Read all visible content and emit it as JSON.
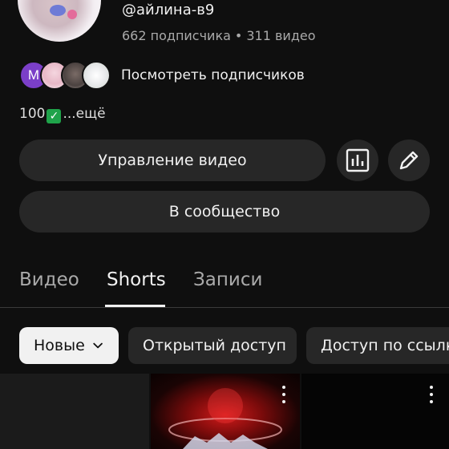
{
  "channel": {
    "handle": "@айлина-в9",
    "subscribers": "662 подписчика",
    "separator": "•",
    "videos": "311 видео",
    "subscriber_avatar_letter": "M",
    "view_subscribers_label": "Посмотреть подписчиков",
    "description_start": "100",
    "description_more": "...ещё"
  },
  "actions": {
    "manage_videos_label": "Управление видео",
    "community_label": "В сообщество",
    "stats_icon": "analytics-icon",
    "edit_icon": "pencil-icon"
  },
  "tabs": [
    {
      "label": "Видео",
      "active": false
    },
    {
      "label": "Shorts",
      "active": true
    },
    {
      "label": "Записи",
      "active": false
    }
  ],
  "filters": {
    "sort_label": "Новые",
    "chips": [
      "Открытый доступ",
      "Доступ по ссылке"
    ]
  },
  "colors": {
    "background": "#0f0f0f",
    "surface": "#272727",
    "text": "#f1f1f1",
    "secondary_text": "#aaaaaa",
    "avatar_m": "#7b3fc8"
  }
}
